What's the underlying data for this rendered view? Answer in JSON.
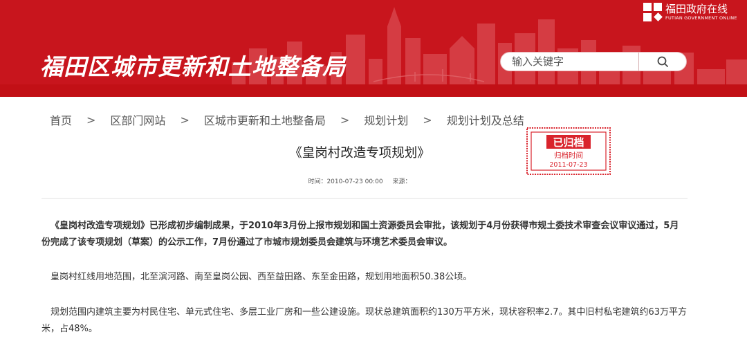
{
  "header": {
    "site_title": "福田区城市更新和土地整备局",
    "portal_name_cn": "福田政府在线",
    "portal_name_en": "FUTIAN GOVERNMENT ONLINE",
    "search_placeholder": "输入关键字",
    "colors": {
      "banner": "#c8151d",
      "skyline": "#d8434a"
    }
  },
  "breadcrumb": {
    "items": [
      "首页",
      "区部门网站",
      "区城市更新和土地整备局",
      "规划计划",
      "规划计划及总结"
    ],
    "separator": ">"
  },
  "stamp": {
    "title": "已归档",
    "label": "归档时间",
    "date": "2011-07-23",
    "color": "#d9232c"
  },
  "article": {
    "title": "《皇岗村改造专项规划》",
    "time_label": "时间：2010-07-23 00:00",
    "source_label": "来源：",
    "paragraphs": [
      "《皇岗村改造专项规划》已形成初步编制成果，于2010年3月份上报市规划和国土资源委员会审批，该规划于4月份获得市规土委技术审查会议审议通过，5月份完成了该专项规划（草案）的公示工作，7月份通过了市城市规划委员会建筑与环境艺术委员会审议。",
      "皇岗村红线用地范围，北至滨河路、南至皇岗公园、西至益田路、东至金田路，规划用地面积50.38公顷。",
      "规划范围内建筑主要为村民住宅、单元式住宅、多层工业厂房和一些公建设施。现状总建筑面积约130万平方米，现状容积率2.7。其中旧村私宅建筑约63万平方米，占48%。"
    ]
  }
}
